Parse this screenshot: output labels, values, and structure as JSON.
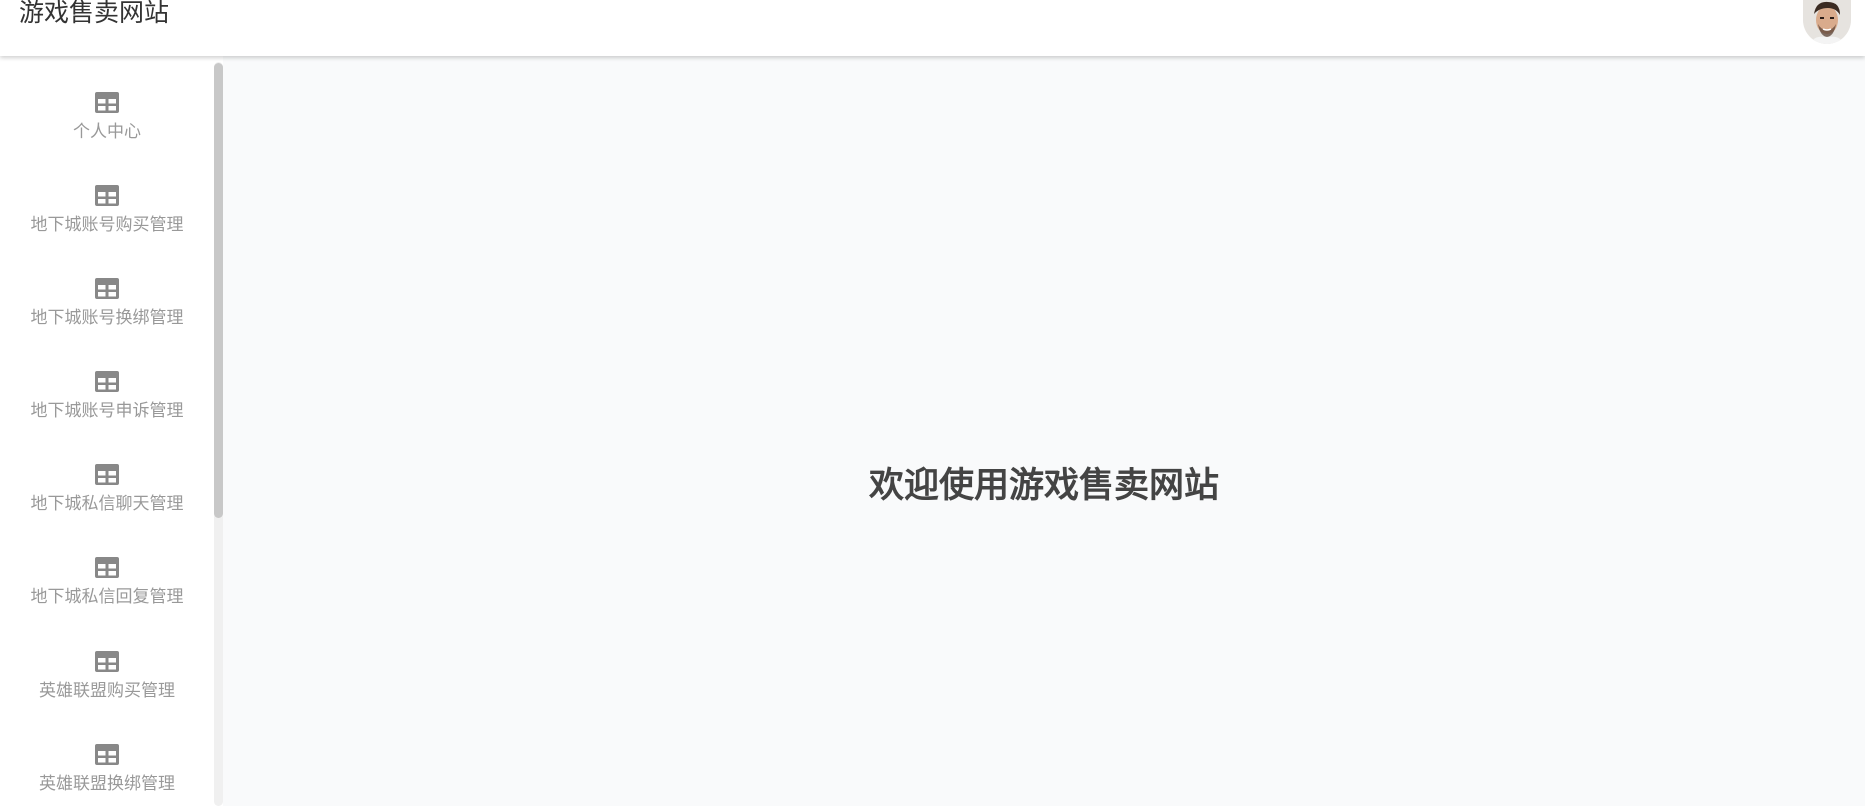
{
  "header": {
    "title": "游戏售卖网站",
    "avatar_icon": "user-avatar"
  },
  "sidebar": {
    "items": [
      {
        "label": "个人中心",
        "icon": "table-icon"
      },
      {
        "label": "地下城账号购买管理",
        "icon": "table-icon"
      },
      {
        "label": "地下城账号换绑管理",
        "icon": "table-icon"
      },
      {
        "label": "地下城账号申诉管理",
        "icon": "table-icon"
      },
      {
        "label": "地下城私信聊天管理",
        "icon": "table-icon"
      },
      {
        "label": "地下城私信回复管理",
        "icon": "table-icon"
      },
      {
        "label": "英雄联盟购买管理",
        "icon": "table-icon"
      },
      {
        "label": "英雄联盟换绑管理",
        "icon": "table-icon"
      }
    ]
  },
  "main": {
    "welcome_text": "欢迎使用游戏售卖网站"
  },
  "colors": {
    "sidebar_text": "#999999",
    "icon": "#888888",
    "welcome_text": "#444444",
    "main_background": "#f9fafb"
  }
}
